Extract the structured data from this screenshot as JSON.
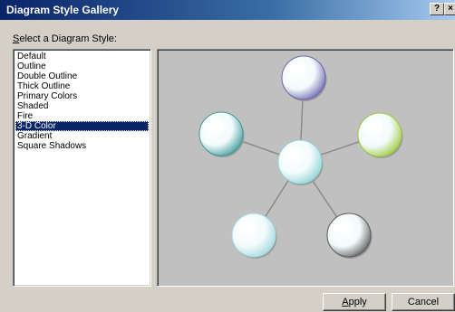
{
  "window": {
    "title": "Diagram Style Gallery",
    "help_glyph": "?",
    "close_glyph": "×"
  },
  "prompt": {
    "accel": "S",
    "rest": "elect a Diagram Style:"
  },
  "styles": [
    "Default",
    "Outline",
    "Double Outline",
    "Thick Outline",
    "Primary Colors",
    "Shaded",
    "Fire",
    "3-D Color",
    "Gradient",
    "Square Shadows"
  ],
  "selected_style": "3-D Color",
  "preview": {
    "background": "#c0c0c0",
    "connector_color": "#8a8a8a",
    "nodes": [
      {
        "role": "center",
        "tint": "#8fd3d6"
      },
      {
        "role": "top",
        "tint": "#6b64b0"
      },
      {
        "role": "right",
        "tint": "#9cc93a"
      },
      {
        "role": "left",
        "tint": "#3f9a9a"
      },
      {
        "role": "bottom-left",
        "tint": "#9ed7de"
      },
      {
        "role": "bottom-right",
        "tint": "#5a5a5a"
      }
    ]
  },
  "buttons": {
    "apply_accel": "A",
    "apply_rest": "pply",
    "cancel": "Cancel"
  }
}
